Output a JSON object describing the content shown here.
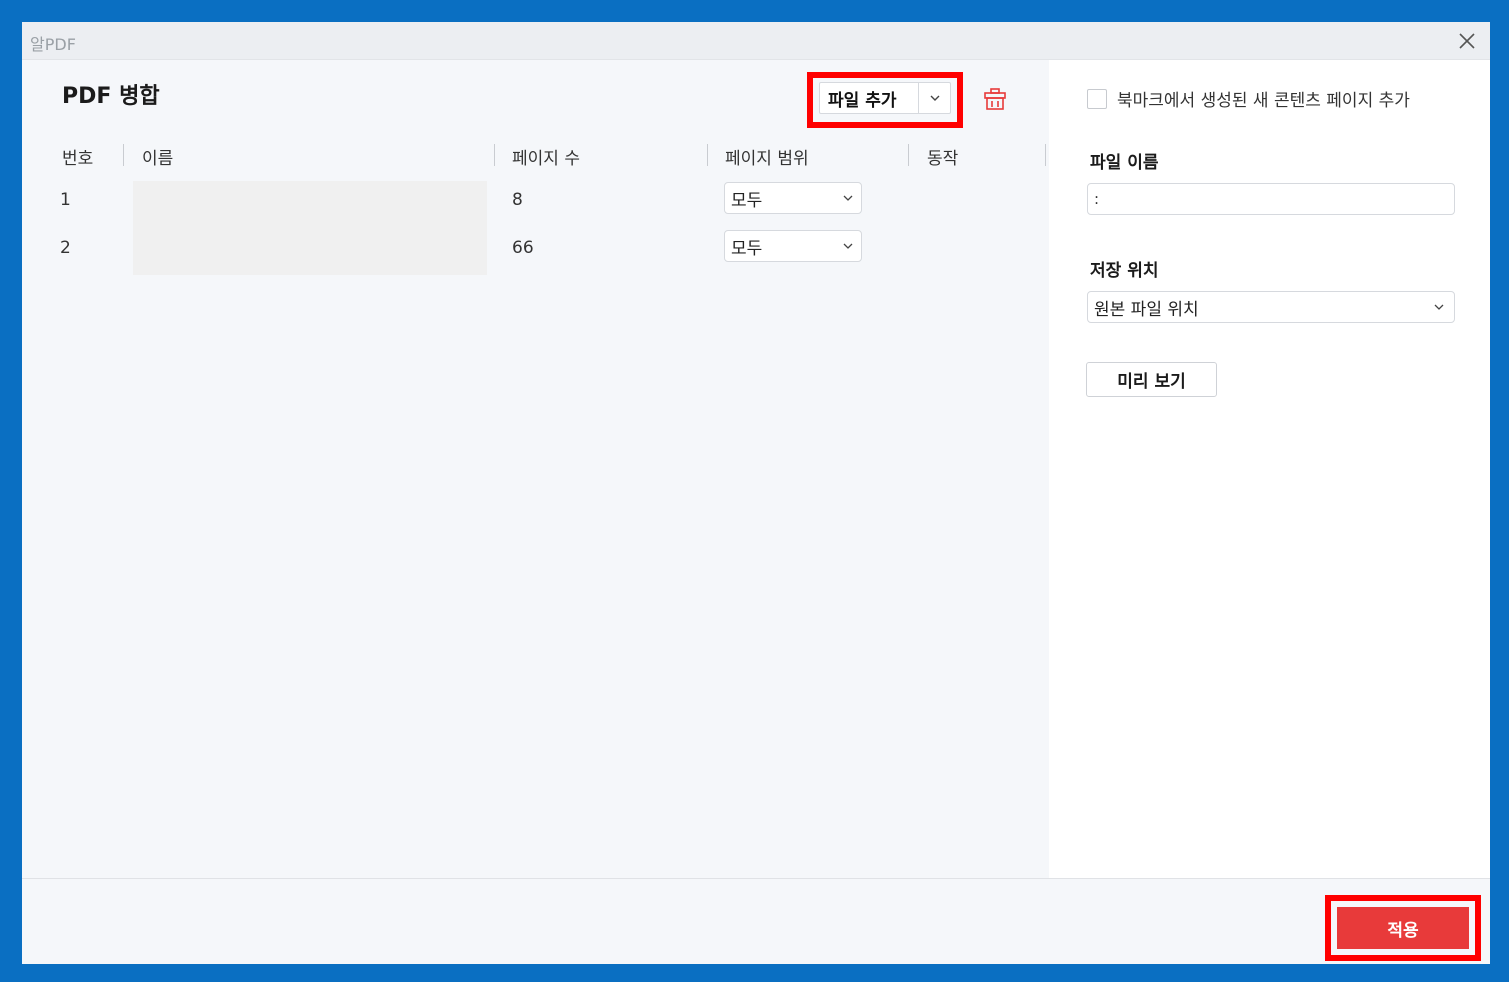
{
  "window": {
    "app_title": "알PDF"
  },
  "left": {
    "title": "PDF 병합",
    "add_file_label": "파일 추가",
    "columns": [
      "번호",
      "이름",
      "페이지 수",
      "페이지 범위",
      "동작"
    ],
    "rows": [
      {
        "num": "1",
        "pages": "8",
        "range": "모두"
      },
      {
        "num": "2",
        "pages": "66",
        "range": "모두"
      }
    ]
  },
  "right": {
    "bookmark_label": "북마크에서 생성된 새 콘텐츠 페이지 추가",
    "file_name_label": "파일 이름",
    "file_name_value": ":",
    "save_location_label": "저장 위치",
    "save_location_value": "원본 파일 위치",
    "preview_label": "미리 보기"
  },
  "footer": {
    "apply_label": "적용"
  },
  "colors": {
    "accent_red": "#e83a3a",
    "highlight": "#ff0000",
    "frame_blue": "#0a6fc2"
  }
}
